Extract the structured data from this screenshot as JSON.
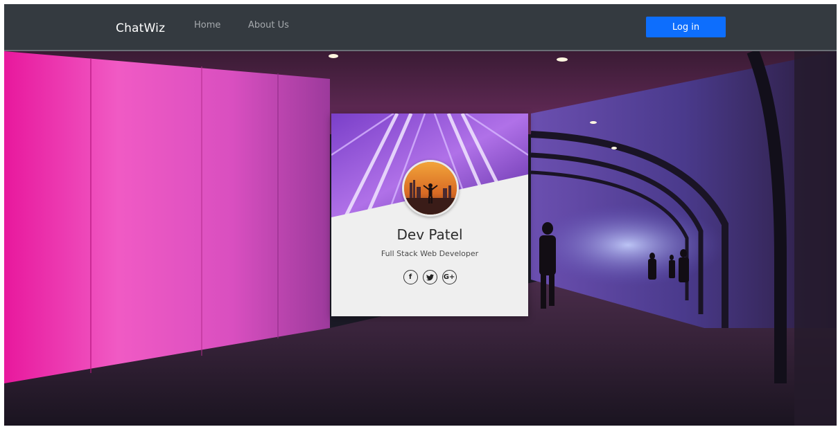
{
  "navbar": {
    "brand": "ChatWiz",
    "links": [
      {
        "label": "Home"
      },
      {
        "label": "About Us"
      }
    ],
    "login_label": "Log in"
  },
  "profile": {
    "name": "Dev Patel",
    "title": "Full Stack Web Developer",
    "socials": [
      {
        "icon": "facebook-icon",
        "glyph": "f"
      },
      {
        "icon": "twitter-icon",
        "glyph": "🐦"
      },
      {
        "icon": "google-plus-icon",
        "glyph": "G+"
      }
    ]
  },
  "colors": {
    "navbar_bg": "#343a40",
    "login_button": "#0d6efd",
    "card_bg": "#efefef",
    "accent_magenta": "#e8119a"
  }
}
